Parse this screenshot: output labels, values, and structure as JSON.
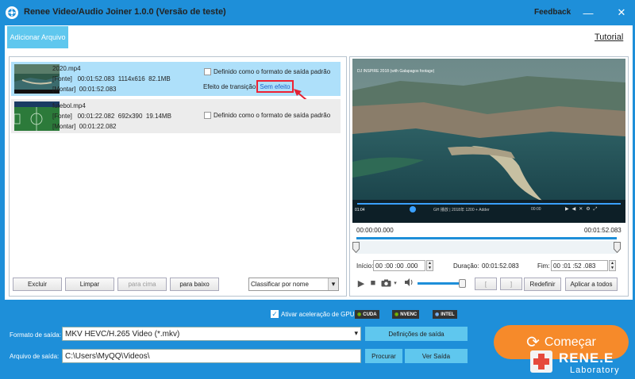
{
  "app": {
    "title": "Renee Video/Audio Joiner 1.0.0 (Versão de teste)",
    "feedback": "Feedback",
    "minimize": "—",
    "close": "✕"
  },
  "toolbar": {
    "add_file": "Adicionar Arquivo",
    "tutorial": "Tutorial"
  },
  "files": [
    {
      "name": "2020.mp4",
      "source_tag": "[Fonte]",
      "source_duration": "00:01:52.083",
      "source_resolution": "1114x616",
      "source_size": "82.1MB",
      "output_tag": "[Montar]",
      "output_duration": "00:01:52.083",
      "default_format_label": "Definido como o formato de saída padrão",
      "transition_label": "Efeito de transição",
      "transition_value": "Sem efeito"
    },
    {
      "name": "futebol.mp4",
      "source_tag": "[Fonte]",
      "source_duration": "00:01:22.082",
      "source_resolution": "692x390",
      "source_size": "19.14MB",
      "output_tag": "[Montar]",
      "output_duration": "00:01:22.082",
      "default_format_label": "Definido como o formato de saída padrão"
    }
  ],
  "list_buttons": {
    "delete": "Excluir",
    "clear": "Limpar",
    "up": "para cima",
    "down": "para baixo"
  },
  "sort": {
    "value": "Classificar por nome"
  },
  "video_overlay": {
    "top_text": "DJ INSPIRE 2018 (with Galapagos footage)",
    "time": "01:04",
    "caption": "GH 播放 | 2018年 1200 + Adder",
    "right_time": "00:00"
  },
  "player": {
    "current_time": "00:00:00.000",
    "end_time": "00:01:52.083",
    "start_label": "Início:",
    "start_value": "00 :00 :00 .000",
    "duration_label": "Duração:",
    "duration_value": "00:01:52.083",
    "end_label": "Fim:",
    "end_value": "00 :01 :52 .083",
    "volume_level": 0.92,
    "redefine": "Redefinir",
    "apply_all": "Aplicar a todos"
  },
  "gpu": {
    "label": "Ativar aceleração de GPU",
    "checked": true,
    "tags": [
      "CUDA",
      "NVENC",
      "INTEL"
    ]
  },
  "output": {
    "format_label": "Formato de saída:",
    "format_value": "MKV HEVC/H.265 Video (*.mkv)",
    "settings_button": "Definições de saída",
    "file_label": "Arquivo de saída:",
    "file_value": "C:\\Users\\MyQQ\\Videos\\",
    "browse_button": "Procurar",
    "view_button": "Ver Saída"
  },
  "start_button": "Começar",
  "brand": {
    "name": "RENE.E",
    "sub": "Laboratory"
  },
  "colors": {
    "accent": "#1e8fd9",
    "highlight": "#aee0fa",
    "start": "#f68a2a",
    "annotation": "#e22233"
  }
}
